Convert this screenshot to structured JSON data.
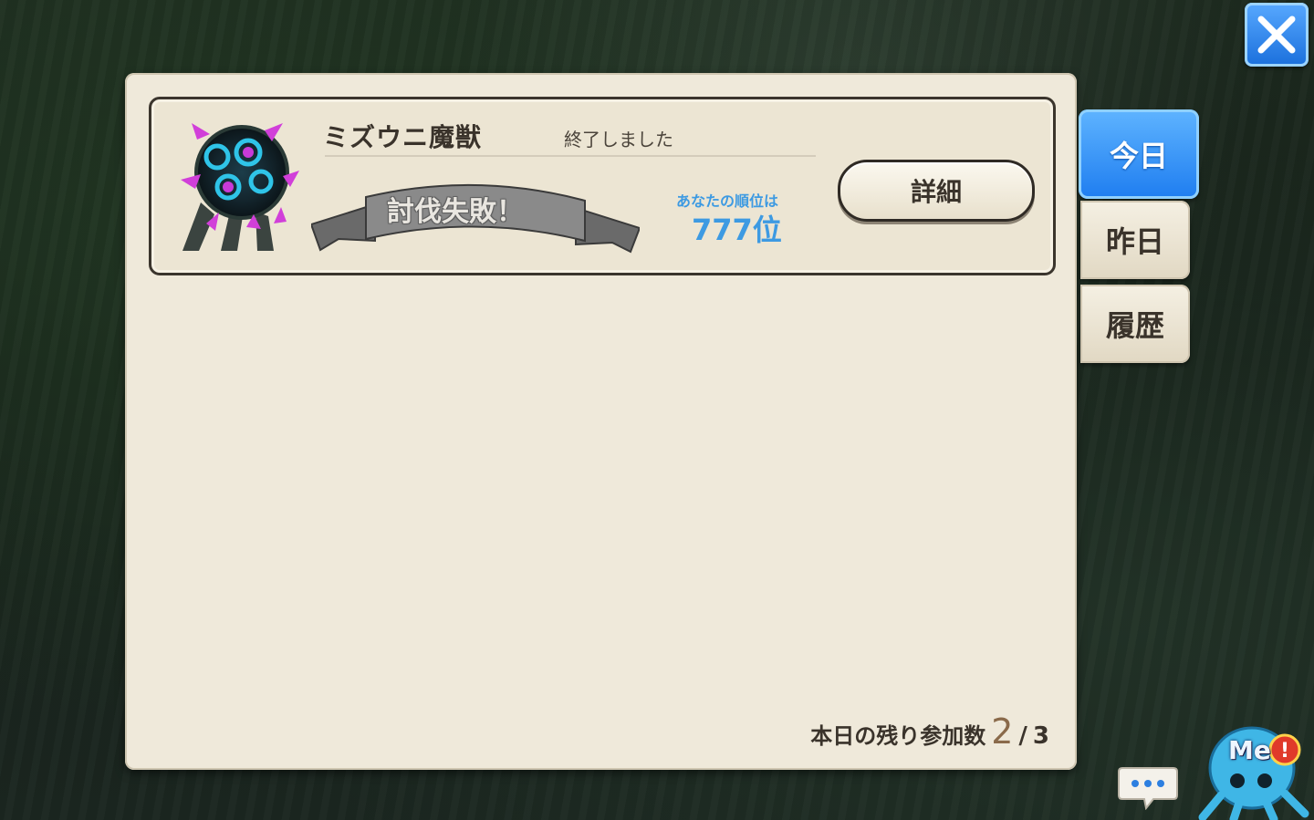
{
  "event": {
    "monster_name": "ミズウニ魔獣",
    "status": "終了しました",
    "result_banner": "討伐失敗！",
    "rank_caption": "あなたの順位は",
    "rank_value": "777位",
    "detail_button": "詳細"
  },
  "tabs": [
    {
      "label": "今日",
      "active": true
    },
    {
      "label": "昨日",
      "active": false
    },
    {
      "label": "履歴",
      "active": false
    }
  ],
  "remaining": {
    "label": "本日の残り参加数",
    "count": "2",
    "separator": "/",
    "total": "3"
  },
  "mascot": {
    "label": "Me"
  },
  "icons": {
    "close": "close-icon",
    "chat": "chat-bubble-icon",
    "monster": "monster-portrait-icon",
    "notification": "exclamation-badge-icon"
  },
  "colors": {
    "panel": "#efe9da",
    "accent_blue": "#1e7df0",
    "rank_blue": "#3d9ae2",
    "text_dark": "#3a332b"
  }
}
